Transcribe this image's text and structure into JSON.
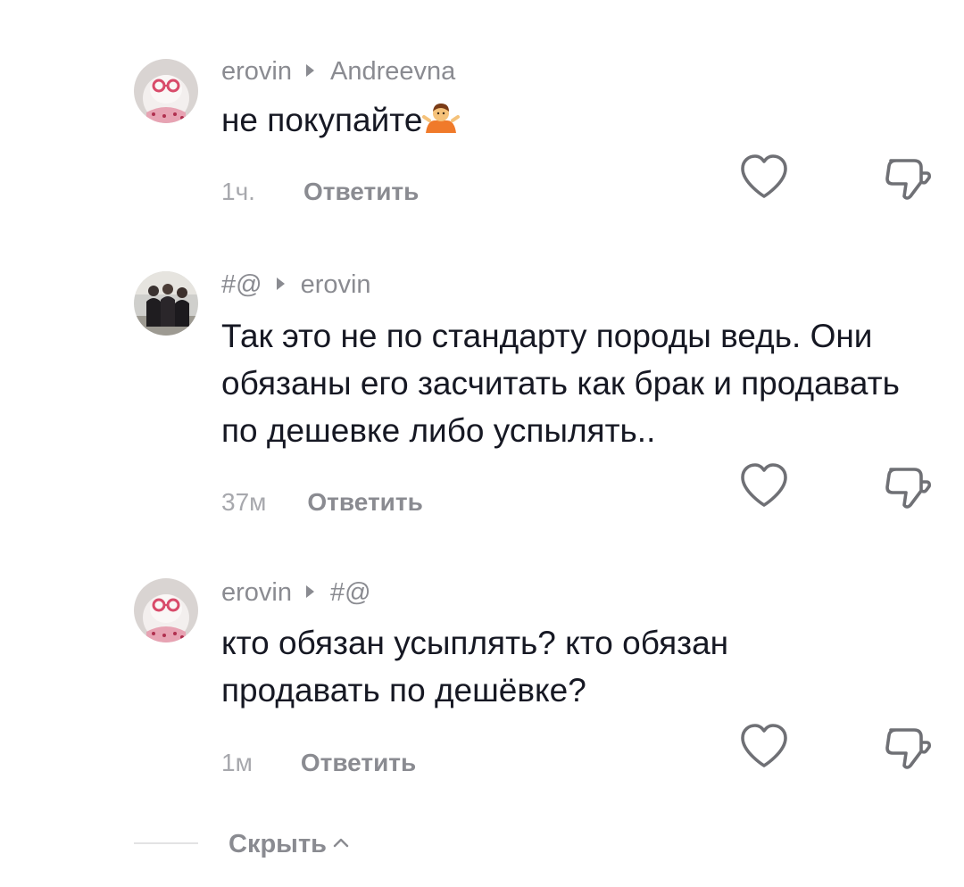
{
  "comments": [
    {
      "author": "erovin",
      "reply_to": "Andreevna",
      "text": "не покупайте",
      "emoji": "person-shrugging-emoji",
      "time": "1ч.",
      "reply_label": "Ответить",
      "avatar": "cat-avatar"
    },
    {
      "author": "#@",
      "reply_to": "erovin",
      "text": "Так это не по стандарту породы ведь. Они обязаны его засчитать как брак и продавать по дешевке либо успылять..",
      "time": "37м",
      "reply_label": "Ответить",
      "avatar": "group-photo-avatar"
    },
    {
      "author": "erovin",
      "reply_to": "#@",
      "text": "кто обязан усыплять? кто обязан продавать по дешёвке?",
      "time": "1м",
      "reply_label": "Ответить",
      "avatar": "cat-avatar"
    }
  ],
  "hide_label": "Скрыть",
  "icons": {
    "like": "heart-outline-icon",
    "dislike": "thumbs-down-outline-icon",
    "hide": "chevron-up-icon"
  },
  "colors": {
    "primary_text": "#161823",
    "secondary_text": "#8a8b91",
    "muted_text": "#a7a8ad",
    "icon_stroke": "#6f7075"
  }
}
